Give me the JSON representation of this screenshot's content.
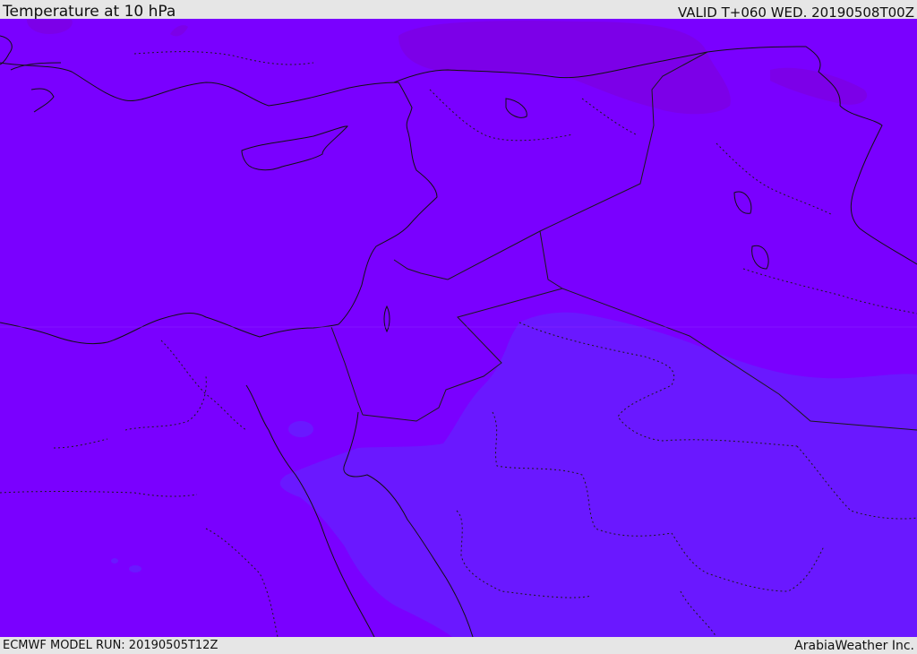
{
  "header": {
    "title": "Temperature at 10 hPa",
    "valid_time": "VALID T+060 WED. 20190508T00Z"
  },
  "footer": {
    "model_run": "ECMWF MODEL RUN: 20190505T12Z",
    "credit": "ArabiaWeather Inc."
  },
  "map": {
    "parameter": "temperature",
    "pressure_level_hpa": 10,
    "colors": {
      "main_fill": "#7a00ff",
      "cooler_region": "#6a1aff",
      "warmer_patches": "#7e00e6",
      "coastline": "#111111",
      "borders": "#1a1a1a"
    }
  }
}
